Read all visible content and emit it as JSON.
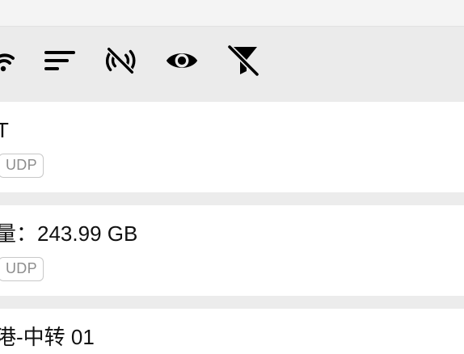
{
  "toolbar": {
    "icons": [
      "wifi-signal-icon",
      "sort-icon",
      "signal-off-icon",
      "eye-icon",
      "filter-off-icon"
    ]
  },
  "rows": [
    {
      "title": "T",
      "tag": "UDP"
    },
    {
      "title": "量：243.99 GB",
      "tag": "UDP"
    },
    {
      "title": "港-中转 01"
    }
  ]
}
